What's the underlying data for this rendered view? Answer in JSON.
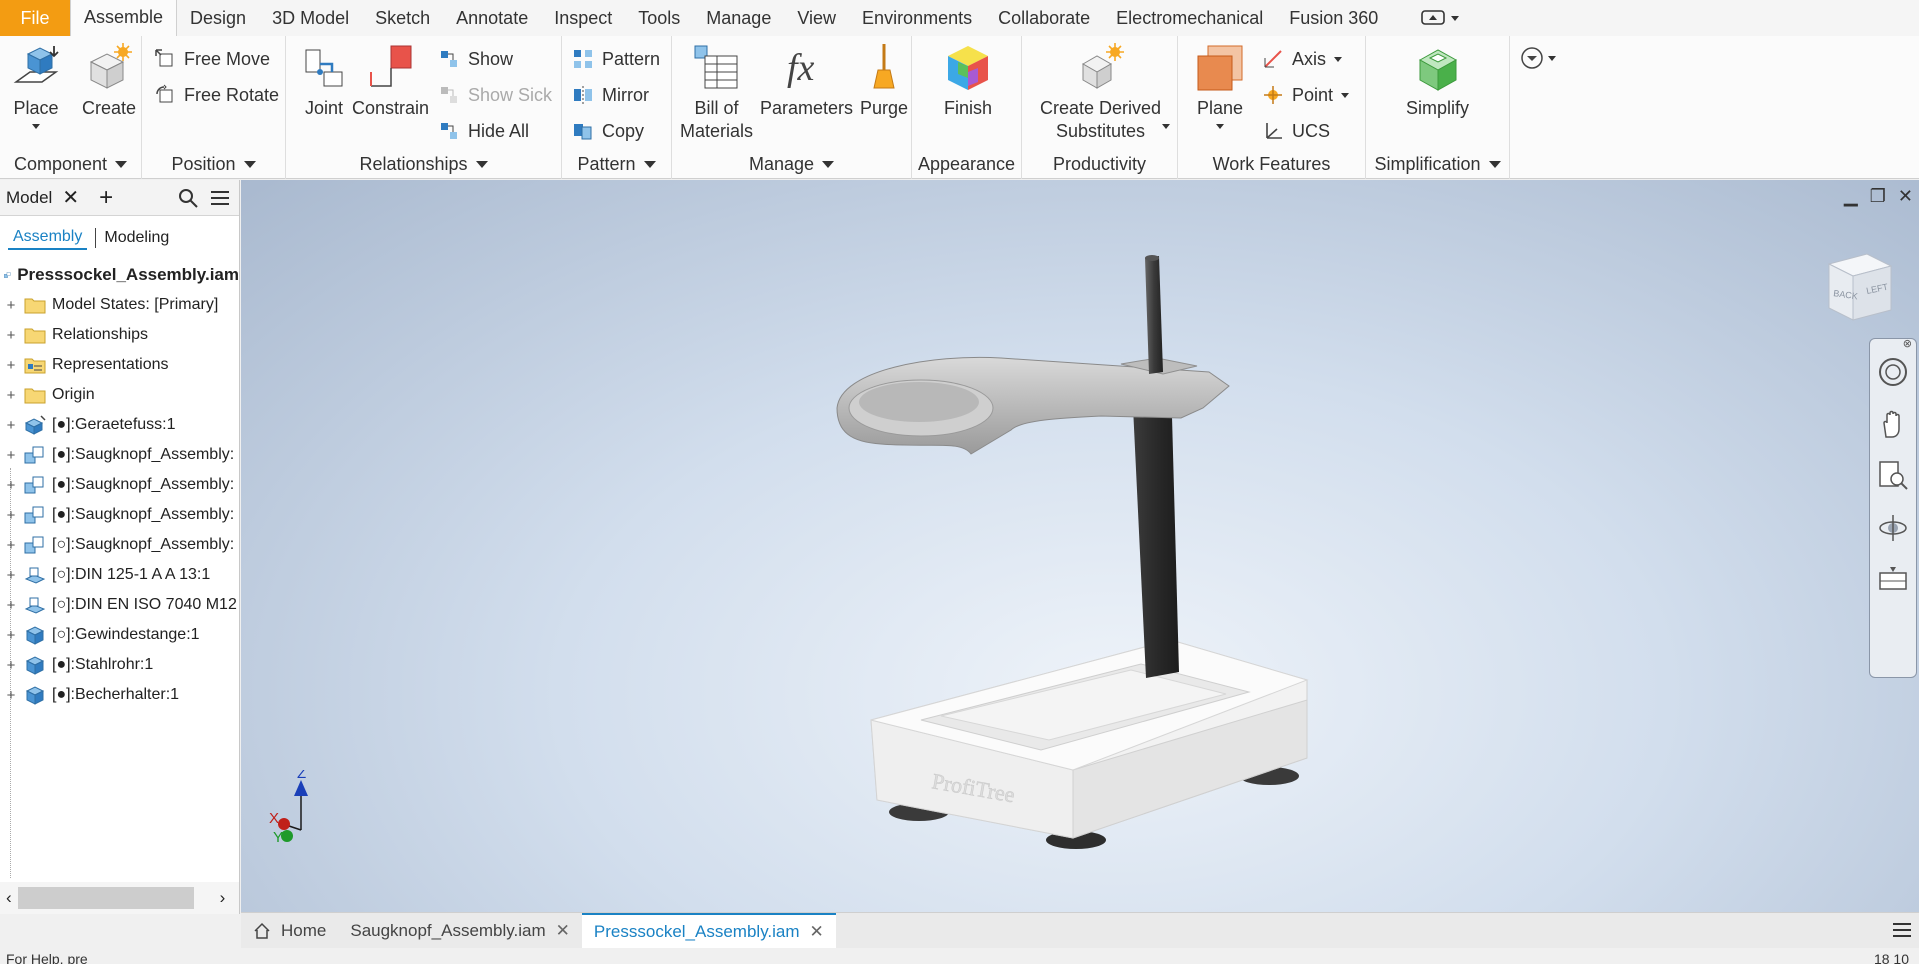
{
  "menu": {
    "file": "File",
    "tabs": [
      "Assemble",
      "Design",
      "3D Model",
      "Sketch",
      "Annotate",
      "Inspect",
      "Tools",
      "Manage",
      "View",
      "Environments",
      "Collaborate",
      "Electromechanical",
      "Fusion 360"
    ],
    "active": "Assemble"
  },
  "ribbon": {
    "component": {
      "label": "Component",
      "place": "Place",
      "create": "Create"
    },
    "position": {
      "label": "Position",
      "free_move": "Free Move",
      "free_rotate": "Free Rotate"
    },
    "relationships": {
      "label": "Relationships",
      "joint": "Joint",
      "constrain": "Constrain",
      "show": "Show",
      "show_sick": "Show Sick",
      "hide_all": "Hide All"
    },
    "pattern": {
      "label": "Pattern",
      "pattern": "Pattern",
      "mirror": "Mirror",
      "copy": "Copy"
    },
    "manage": {
      "label": "Manage",
      "bom_line1": "Bill of",
      "bom_line2": "Materials",
      "parameters": "Parameters",
      "purge": "Purge"
    },
    "appearance": {
      "label": "Appearance",
      "finish": "Finish"
    },
    "productivity": {
      "label": "Productivity",
      "derived_line1": "Create Derived",
      "derived_line2": "Substitutes"
    },
    "work_features": {
      "label": "Work Features",
      "plane": "Plane",
      "axis": "Axis",
      "point": "Point",
      "ucs": "UCS"
    },
    "simplification": {
      "label": "Simplification",
      "simplify": "Simplify"
    }
  },
  "browser": {
    "title": "Model",
    "tab_assembly": "Assembly",
    "tab_modeling": "Modeling",
    "root": "Presssockel_Assembly.iam",
    "items": [
      {
        "label": "Model States: [Primary]",
        "icon": "folder"
      },
      {
        "label": "Relationships",
        "icon": "folder"
      },
      {
        "label": "Representations",
        "icon": "representations"
      },
      {
        "label": "Origin",
        "icon": "folder"
      },
      {
        "label": "[●]:Geraetefuss:1",
        "icon": "part-grounded"
      },
      {
        "label": "[●]:Saugknopf_Assembly:",
        "icon": "assembly"
      },
      {
        "label": "[●]:Saugknopf_Assembly:",
        "icon": "assembly"
      },
      {
        "label": "[●]:Saugknopf_Assembly:",
        "icon": "assembly"
      },
      {
        "label": "[○]:Saugknopf_Assembly:",
        "icon": "assembly"
      },
      {
        "label": "[○]:DIN 125-1 A A 13:1",
        "icon": "library-part"
      },
      {
        "label": "[○]:DIN EN ISO 7040 M12",
        "icon": "library-part"
      },
      {
        "label": "[○]:Gewindestange:1",
        "icon": "part"
      },
      {
        "label": "[●]:Stahlrohr:1",
        "icon": "part"
      },
      {
        "label": "[●]:Becherhalter:1",
        "icon": "part"
      }
    ]
  },
  "viewport": {
    "viewcube_back": "BACK",
    "viewcube_left": "LEFT",
    "model_engraving": "ProfiTree",
    "triad_z": "Z",
    "triad_x": "X",
    "triad_y": "Y"
  },
  "doc_tabs": {
    "home": "Home",
    "tab1": "Saugknopf_Assembly.iam",
    "tab2": "Presssockel_Assembly.iam"
  },
  "status": {
    "left": "For Help, pre",
    "right": "18  10"
  }
}
